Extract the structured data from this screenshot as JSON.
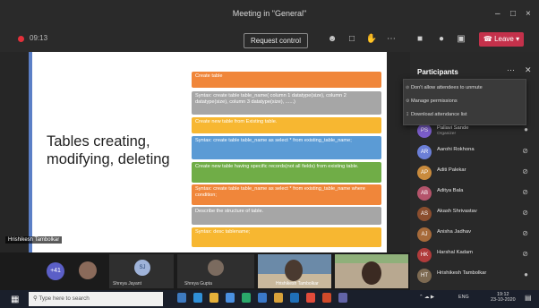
{
  "window": {
    "title": "Meeting in \"General\"",
    "minimize": "–",
    "maximize": "□",
    "close": "×"
  },
  "toolbar": {
    "timer": "09:13",
    "request_control": "Request control",
    "leave": "Leave",
    "icons": [
      "people-icon",
      "chat-icon",
      "raise-hand-icon",
      "more-icon",
      "camera-icon",
      "mic-icon",
      "share-icon"
    ]
  },
  "slide": {
    "title_line1": "Tables creating,",
    "title_line2": "modifying, deleting",
    "boxes": [
      {
        "text": "Create table",
        "color": "#f0863a"
      },
      {
        "text": "Syntax: create table table_name( column 1 datatype(size), column 2 datatype(size), column 3 datatype(size), ......)",
        "color": "#a6a6a6"
      },
      {
        "text": "Create new table from Existing table.",
        "color": "#f7b731"
      },
      {
        "text": "Syntax: create table table_name as select * from existing_table_name;",
        "color": "#5b9bd5"
      },
      {
        "text": "Create new table having specific records(not all fields) from existing table.",
        "color": "#70ad47"
      },
      {
        "text": "Syntax: create table table_name as select * from existing_table_name where condition;",
        "color": "#f0863a"
      },
      {
        "text": "Describe the structure of table.",
        "color": "#a6a6a6"
      },
      {
        "text": "Syntax: desc tablename;",
        "color": "#f7b731"
      }
    ],
    "presenter": "Hrishikesh Tambolkar"
  },
  "participants": {
    "title": "Participants",
    "menu": [
      "Don't allow attendees to unmute",
      "Manage permissions",
      "Download attendance list"
    ],
    "list": [
      {
        "name": "Pallavi Sande",
        "sub": "Organizer",
        "initials": "PS",
        "color": "#7a5cc9"
      },
      {
        "name": "Aarohi Rokhona",
        "sub": "",
        "initials": "AR",
        "color": "#6b7fd7"
      },
      {
        "name": "Aditi Palekar",
        "sub": "",
        "initials": "AP",
        "color": "#c98b3d"
      },
      {
        "name": "Aditya Bala",
        "sub": "",
        "initials": "AB",
        "color": "#b4546b"
      },
      {
        "name": "Akash Shrivastav",
        "sub": "",
        "initials": "AS",
        "color": "#8b4e2e"
      },
      {
        "name": "Anisha Jadhav",
        "sub": "",
        "initials": "AJ",
        "color": "#a66a3a"
      },
      {
        "name": "Harshal Kadam",
        "sub": "",
        "initials": "HK",
        "color": "#b03b3b"
      },
      {
        "name": "Hrishikesh Tambolkar",
        "sub": "",
        "initials": "HT",
        "color": "#7d6a52"
      }
    ]
  },
  "strip": {
    "more_count": "+41",
    "tiles": [
      {
        "name": "Shreya Jayant",
        "initials": "SJ"
      },
      {
        "name": "Shreya Gupta",
        "initials": ""
      },
      {
        "name": "Hrishikesh Tambolkar",
        "initials": ""
      },
      {
        "name": "",
        "initials": ""
      }
    ]
  },
  "taskbar": {
    "search_placeholder": "Type here to search",
    "tray_text": "ENG",
    "time": "19:12",
    "date": "23-10-2020"
  }
}
